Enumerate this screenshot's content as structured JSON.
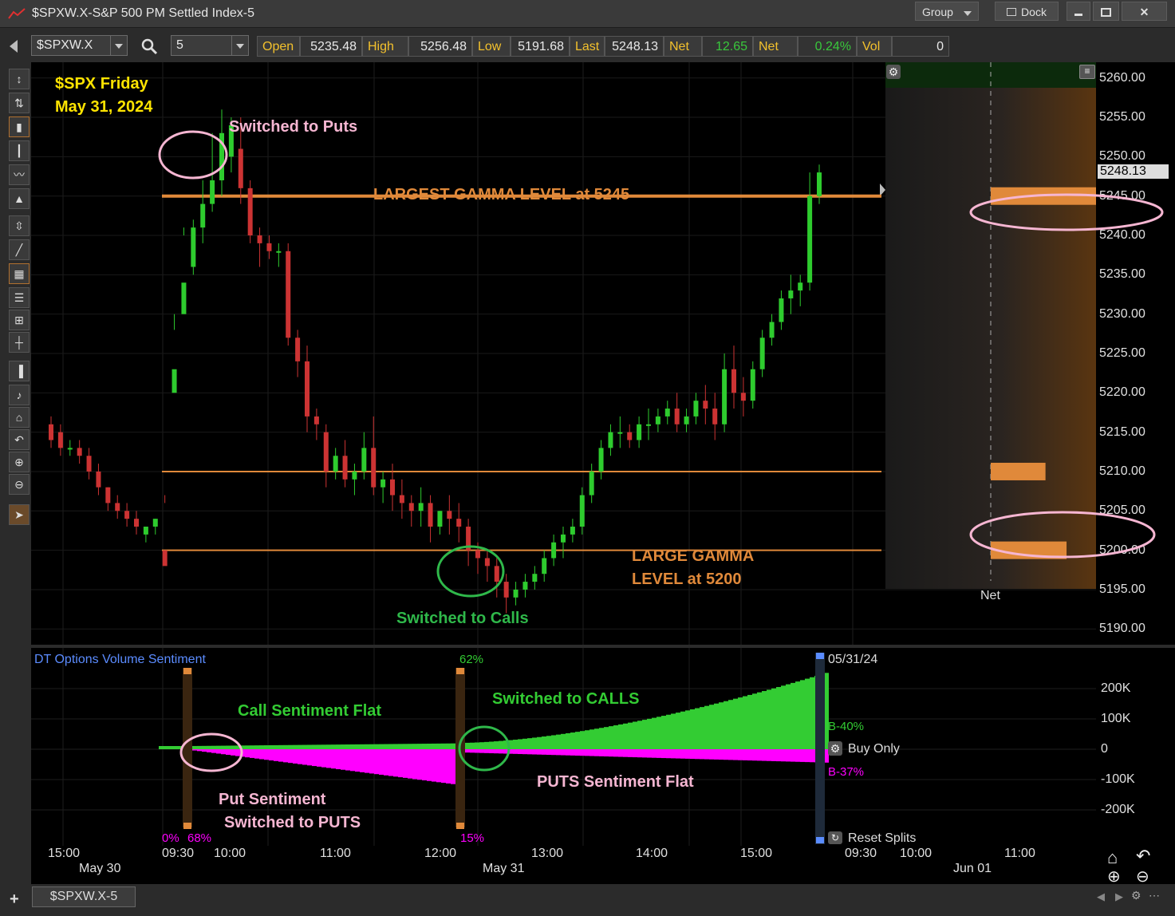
{
  "window": {
    "title": "$SPXW.X-S&P 500 PM Settled Index-5",
    "group_label": "Group",
    "dock_label": "Dock",
    "min_icon": "minimize-icon",
    "max_icon": "maximize-icon",
    "close_icon": "close-icon"
  },
  "toolbar": {
    "symbol": "$SPXW.X",
    "interval": "5",
    "quote": [
      {
        "label": "Open",
        "value": "5235.48",
        "value_color": "#e8e8e8"
      },
      {
        "label": "High",
        "value": "5256.48",
        "value_color": "#e8e8e8"
      },
      {
        "label": "Low",
        "value": "5191.68",
        "value_color": "#e8e8e8"
      },
      {
        "label": "Last",
        "value": "5248.13",
        "value_color": "#e8e8e8"
      },
      {
        "label": "Net",
        "value": "12.65",
        "value_color": "#39c83c"
      },
      {
        "label": "Net %",
        "value": "0.24%",
        "value_color": "#39c83c"
      },
      {
        "label": "Vol",
        "value": "0",
        "value_color": "#e8e8e8"
      }
    ]
  },
  "annotations": {
    "header_line1": "$SPX Friday",
    "header_line2": "May 31, 2024",
    "switched_puts": "Switched to Puts",
    "largest_gamma": "LARGEST GAMMA LEVEL at 5245",
    "large_gamma_line1": "LARGE GAMMA",
    "large_gamma_line2": "LEVEL at 5200",
    "switched_calls": "Switched to Calls",
    "call_flat": "Call Sentiment Flat",
    "switched_calls_caps": "Switched to CALLS",
    "put_line1": "Put Sentiment",
    "put_line2": "Switched to PUTS",
    "puts_flat": "PUTS Sentiment Flat"
  },
  "price_axis": {
    "ticks": [
      "5260.00",
      "5255.00",
      "5250.00",
      "5245.00",
      "5240.00",
      "5235.00",
      "5230.00",
      "5225.00",
      "5220.00",
      "5215.00",
      "5210.00",
      "5205.00",
      "5200.00",
      "5195.00",
      "5190.00"
    ],
    "last_marker": "5248.13",
    "net_label": "Net"
  },
  "sentiment": {
    "title": "DT Options Volume Sentiment",
    "pct_62": "62%",
    "pct_0": "0%",
    "pct_68": "68%",
    "pct_15": "15%",
    "date_label": "05/31/24",
    "b_call": "B-40%",
    "b_put": "B-37%",
    "buy_only": "Buy Only",
    "reset_splits": "Reset Splits",
    "ticks": [
      "200K",
      "100K",
      "0",
      "-100K",
      "-200K"
    ]
  },
  "time_axis": {
    "times": [
      "15:00",
      "09:30",
      "10:00",
      "11:00",
      "12:00",
      "13:00",
      "14:00",
      "15:00",
      "09:30",
      "10:00",
      "11:00"
    ],
    "dates": [
      "May 30",
      "May 31",
      "Jun 01"
    ]
  },
  "bottom": {
    "tab_label": "$SPXW.X-5",
    "add_icon": "plus-icon"
  },
  "colors": {
    "up": "#2ecc2e",
    "down": "#cc3333",
    "gamma": "#e0893a",
    "pink": "#f6b6d2",
    "green_ann": "#2fb84a",
    "yellow": "#ffe400",
    "magenta": "#ff00ff",
    "call_green": "#33cc33"
  },
  "chart_data": {
    "type": "candlestick",
    "candles": [
      [
        5216,
        5217,
        5214,
        5213
      ],
      [
        5215,
        5216,
        5213,
        5212
      ],
      [
        5213,
        5214,
        5213,
        5212
      ],
      [
        5213,
        5214,
        5212,
        5211
      ],
      [
        5212,
        5213,
        5210,
        5209
      ],
      [
        5210,
        5211,
        5208,
        5207
      ],
      [
        5208,
        5208,
        5206,
        5205
      ],
      [
        5206,
        5207,
        5205,
        5204
      ],
      [
        5205,
        5206,
        5204,
        5203
      ],
      [
        5204,
        5205,
        5203,
        5202
      ],
      [
        5202,
        5203,
        5203,
        5201
      ],
      [
        5203,
        5204,
        5204,
        5202
      ],
      [
        5200,
        5206,
        5198,
        5207
      ],
      [
        5220,
        5228,
        5223,
        5230
      ],
      [
        5230,
        5240,
        5234,
        5241
      ],
      [
        5236,
        5242,
        5241,
        5235
      ],
      [
        5241,
        5247,
        5244,
        5239
      ],
      [
        5244,
        5253,
        5247,
        5243
      ],
      [
        5247,
        5256,
        5253,
        5245
      ],
      [
        5250,
        5255,
        5254,
        5248
      ],
      [
        5251,
        5255,
        5246,
        5244
      ],
      [
        5246,
        5247,
        5240,
        5239
      ],
      [
        5240,
        5241,
        5239,
        5236
      ],
      [
        5239,
        5240,
        5238,
        5237
      ],
      [
        5238,
        5239,
        5238,
        5236
      ],
      [
        5238,
        5239,
        5227,
        5226
      ],
      [
        5227,
        5228,
        5224,
        5222
      ],
      [
        5224,
        5226,
        5217,
        5215
      ],
      [
        5217,
        5218,
        5216,
        5214
      ],
      [
        5215,
        5216,
        5210,
        5208
      ],
      [
        5210,
        5213,
        5212,
        5209
      ],
      [
        5212,
        5214,
        5209,
        5208
      ],
      [
        5209,
        5211,
        5210,
        5207
      ],
      [
        5210,
        5215,
        5213,
        5209
      ],
      [
        5213,
        5217,
        5208,
        5207
      ],
      [
        5208,
        5210,
        5209,
        5206
      ],
      [
        5209,
        5211,
        5207,
        5205
      ],
      [
        5207,
        5209,
        5206,
        5204
      ],
      [
        5206,
        5207,
        5205,
        5203
      ],
      [
        5205,
        5208,
        5206,
        5203
      ],
      [
        5206,
        5207,
        5203,
        5201
      ],
      [
        5203,
        5205,
        5205,
        5202
      ],
      [
        5205,
        5207,
        5204,
        5202
      ],
      [
        5204,
        5206,
        5203,
        5201
      ],
      [
        5203,
        5204,
        5200,
        5198
      ],
      [
        5200,
        5201,
        5199,
        5197
      ],
      [
        5199,
        5200,
        5198,
        5196
      ],
      [
        5198,
        5199,
        5196,
        5194
      ],
      [
        5196,
        5197,
        5194,
        5192
      ],
      [
        5194,
        5196,
        5195,
        5193
      ],
      [
        5195,
        5197,
        5196,
        5194
      ],
      [
        5196,
        5198,
        5197,
        5195
      ],
      [
        5197,
        5200,
        5199,
        5196
      ],
      [
        5199,
        5202,
        5201,
        5198
      ],
      [
        5201,
        5203,
        5202,
        5199
      ],
      [
        5202,
        5204,
        5203,
        5201
      ],
      [
        5203,
        5208,
        5207,
        5202
      ],
      [
        5207,
        5211,
        5210,
        5206
      ],
      [
        5210,
        5214,
        5213,
        5209
      ],
      [
        5213,
        5216,
        5215,
        5212
      ],
      [
        5215,
        5217,
        5215,
        5213
      ],
      [
        5215,
        5216,
        5214,
        5213
      ],
      [
        5214,
        5217,
        5216,
        5213
      ],
      [
        5216,
        5218,
        5216,
        5214
      ],
      [
        5216,
        5218,
        5217,
        5215
      ],
      [
        5217,
        5219,
        5218,
        5216
      ],
      [
        5218,
        5220,
        5216,
        5215
      ],
      [
        5216,
        5218,
        5217,
        5215
      ],
      [
        5217,
        5220,
        5219,
        5216
      ],
      [
        5219,
        5221,
        5218,
        5216
      ],
      [
        5218,
        5220,
        5216,
        5214
      ],
      [
        5216,
        5225,
        5223,
        5215
      ],
      [
        5223,
        5226,
        5220,
        5218
      ],
      [
        5220,
        5222,
        5219,
        5217
      ],
      [
        5219,
        5224,
        5223,
        5218
      ],
      [
        5223,
        5228,
        5227,
        5222
      ],
      [
        5227,
        5230,
        5229,
        5226
      ],
      [
        5229,
        5233,
        5232,
        5228
      ],
      [
        5232,
        5235,
        5233,
        5230
      ],
      [
        5233,
        5235,
        5234,
        5231
      ],
      [
        5234,
        5248,
        5245,
        5233
      ],
      [
        5245,
        5249,
        5248,
        5244
      ]
    ],
    "levels": [
      5245,
      5210,
      5200
    ],
    "gamma_bars": [
      {
        "level": 5245,
        "size": 1.0
      },
      {
        "level": 5210,
        "size": 0.52
      },
      {
        "level": 5200,
        "size": 0.72
      }
    ],
    "ylim": [
      5188,
      5262
    ]
  }
}
